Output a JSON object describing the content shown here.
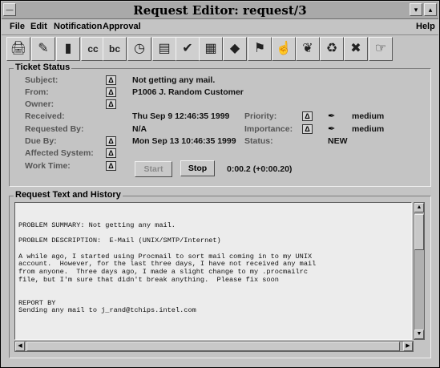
{
  "window": {
    "title": "Request Editor: request/3"
  },
  "menubar": {
    "file": "File",
    "edit": "Edit",
    "notification": "Notification",
    "approval": "Approval",
    "help": "Help"
  },
  "toolbar": {
    "icons": [
      "printer-icon",
      "pencil-icon",
      "stoplight-icon",
      "cc-icon",
      "bcc-icon",
      "clock-icon",
      "clipboard-icon",
      "checkmark-icon",
      "notepad-icon",
      "diamond-icon",
      "flag-icon",
      "hand-icon",
      "chili-icon",
      "recycle-icon",
      "x-icon",
      "point-hand-icon"
    ],
    "glyphs": [
      "🖨",
      "✎",
      "▮",
      "cc",
      "bc",
      "◷",
      "▤",
      "✔",
      "▦",
      "◆",
      "⚑",
      "☝",
      "❦",
      "♻",
      "✖",
      "☞"
    ]
  },
  "ticket_status": {
    "group_title": "Ticket Status",
    "subject_label": "Subject:",
    "subject_value": "Not getting any mail.",
    "from_label": "From:",
    "from_value": "P1006  J. Random Customer",
    "owner_label": "Owner:",
    "owner_value": "",
    "received_label": "Received:",
    "received_value": "Thu Sep  9 12:46:35 1999",
    "requested_by_label": "Requested By:",
    "requested_by_value": "N/A",
    "due_by_label": "Due By:",
    "due_by_value": "Mon Sep 13 10:46:35 1999",
    "affected_system_label": "Affected System:",
    "affected_system_value": "",
    "work_time_label": "Work Time:",
    "priority_label": "Priority:",
    "priority_value": "medium",
    "importance_label": "Importance:",
    "importance_value": "medium",
    "status_label": "Status:",
    "status_value": "NEW",
    "start_button": "Start",
    "stop_button": "Stop",
    "timer": "0:00.2 (+0:00.20)",
    "delta_glyph": "Δ"
  },
  "history": {
    "group_title": "Request Text and History",
    "text": "\nPROBLEM SUMMARY: Not getting any mail.\n\nPROBLEM DESCRIPTION:  E-Mail (UNIX/SMTP/Internet)\n\nA while ago, I started using Procmail to sort mail coming in to my UNIX\naccount.  However, for the last three days, I have not received any mail\nfrom anyone.  Three days ago, I made a slight change to my .procmailrc\nfile, but I'm sure that didn't break anything.  Please fix soon\n\n\nREPORT BY\nSending any mail to j_rand@tchips.intel.com"
  }
}
